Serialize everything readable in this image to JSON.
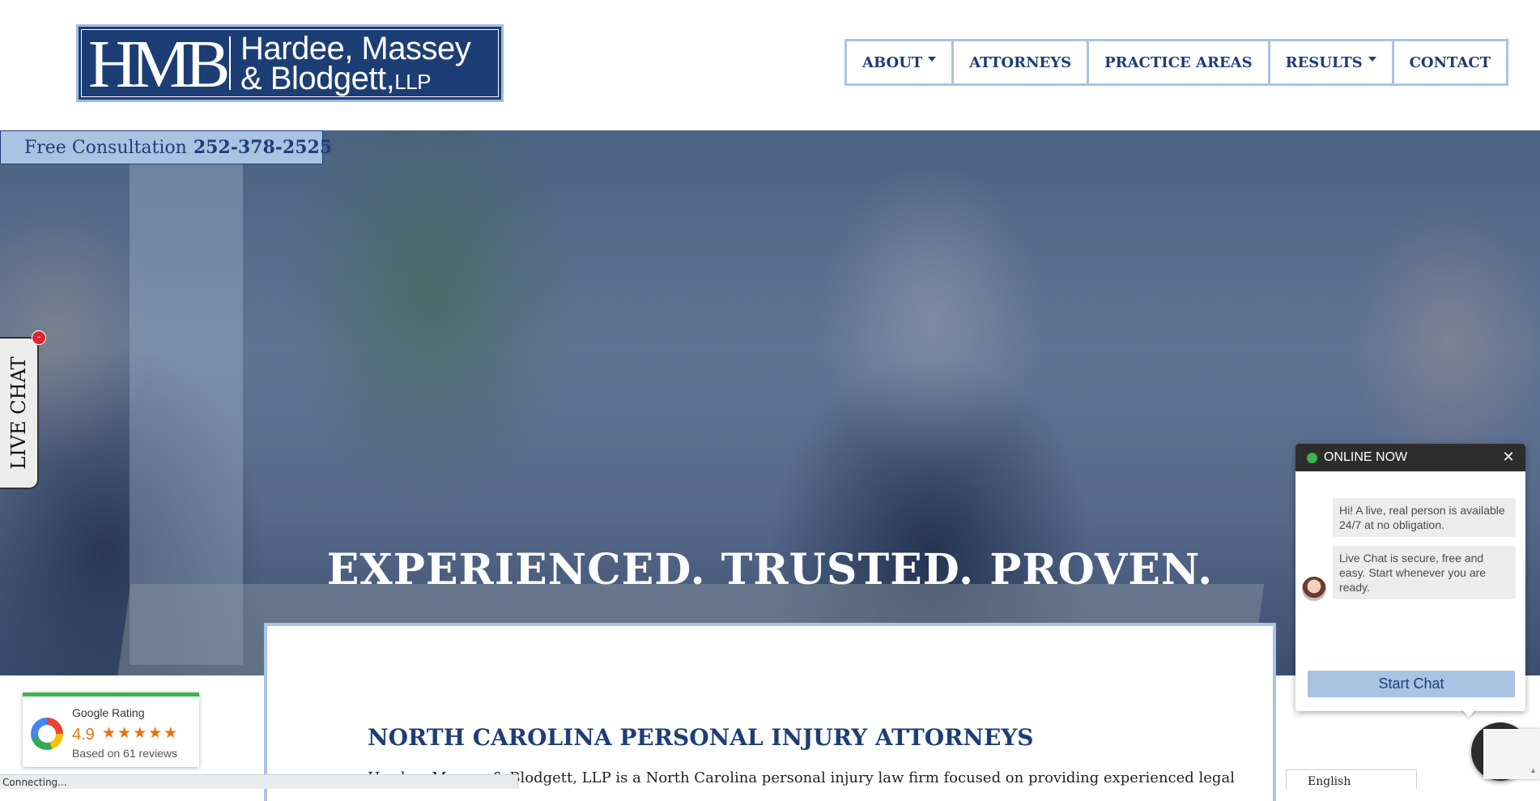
{
  "header": {
    "logo_monogram": "HMB",
    "logo_line1": "Hardee, Massey",
    "logo_line2": "& Blodgett,",
    "logo_llp": "LLP"
  },
  "nav": {
    "items": [
      {
        "label": "ABOUT",
        "has_dropdown": true
      },
      {
        "label": "ATTORNEYS",
        "has_dropdown": false
      },
      {
        "label": "PRACTICE AREAS",
        "has_dropdown": false
      },
      {
        "label": "RESULTS",
        "has_dropdown": true
      },
      {
        "label": "CONTACT",
        "has_dropdown": false
      }
    ]
  },
  "consultation": {
    "label": "Free Consultation",
    "phone": "252-378-2525"
  },
  "hero": {
    "title": "EXPERIENCED. TRUSTED. PROVEN."
  },
  "live_chat_tab": {
    "label": "LIVE CHAT"
  },
  "content": {
    "section_title": "NORTH CAROLINA PERSONAL INJURY ATTORNEYS",
    "intro_text": "Hardee, Massey & Blodgett, LLP is a North Carolina personal injury law firm focused on providing experienced legal"
  },
  "google_rating": {
    "label": "Google Rating",
    "score": "4.9",
    "stars": "★★★★★",
    "reviews": "Based on 61 reviews"
  },
  "chat_widget": {
    "status": "ONLINE NOW",
    "messages": [
      "Hi! A live, real person is available 24/7 at no obligation.",
      "Live Chat is secure, free and easy. Start whenever you are ready."
    ],
    "button": "Start Chat"
  },
  "language": {
    "selected": "English"
  },
  "status_bar": {
    "text": "Connecting..."
  },
  "colors": {
    "brand_navy": "#1d3e75",
    "accent_light_blue": "#a9c3e3",
    "online_green": "#3bb54a",
    "star_orange": "#e8710a"
  }
}
